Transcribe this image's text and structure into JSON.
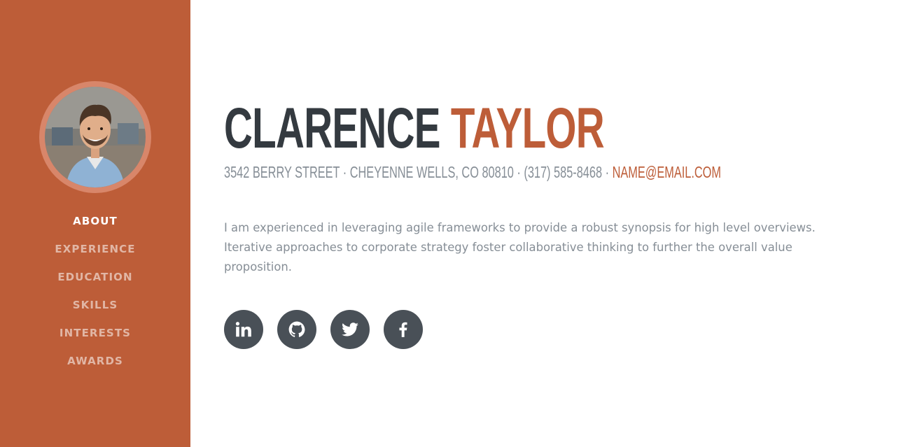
{
  "colors": {
    "accent": "#bd5d38",
    "sidebar_bg": "#bd5d38",
    "heading": "#343a40",
    "muted_text": "#868e96",
    "social_bg": "#495057"
  },
  "sidebar": {
    "avatar_alt": "profile photo",
    "nav": [
      {
        "label": "ABOUT",
        "active": true
      },
      {
        "label": "EXPERIENCE",
        "active": false
      },
      {
        "label": "EDUCATION",
        "active": false
      },
      {
        "label": "SKILLS",
        "active": false
      },
      {
        "label": "INTERESTS",
        "active": false
      },
      {
        "label": "AWARDS",
        "active": false
      }
    ]
  },
  "header": {
    "first_name": "CLARENCE",
    "last_name": "TAYLOR",
    "address": "3542 BERRY STREET · CHEYENNE WELLS, CO 80810 · (317) 585-8468 ·",
    "email": "NAME@EMAIL.COM"
  },
  "bio": "I am experienced in leveraging agile frameworks to provide a robust synopsis for high level overviews. Iterative approaches to corporate strategy foster collaborative thinking to further the overall value proposition.",
  "social": [
    {
      "icon": "linkedin-icon"
    },
    {
      "icon": "github-icon"
    },
    {
      "icon": "twitter-icon"
    },
    {
      "icon": "facebook-icon"
    }
  ]
}
